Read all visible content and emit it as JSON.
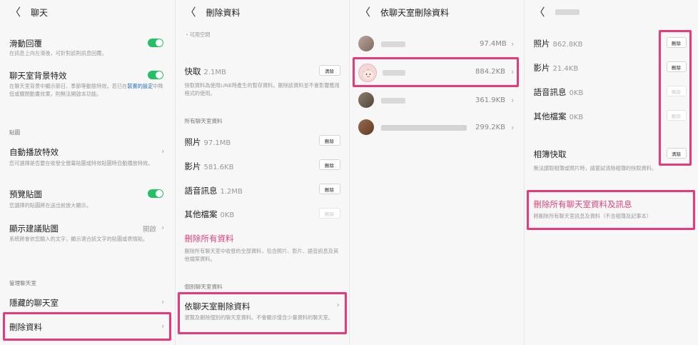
{
  "panel1": {
    "header": {
      "back": "〈",
      "title": "聊天"
    },
    "items": [
      {
        "title": "滑動回覆",
        "desc": "在訊息上向左滑後，可針對該則訊息回覆。"
      },
      {
        "title": "聊天室背景特效",
        "desc1": "在聊天室背景中顯示節日、季節等動態特效。若已在",
        "desc_link": "裝置的設定",
        "desc2": "中降低或關閉動畫效果，則無法開啟本功能。"
      }
    ],
    "section_sticker": "貼圖",
    "autoplay": {
      "title": "自動播放特效",
      "desc": "您可選擇是否要在收發全螢幕貼圖或特效貼圖時自動播放特效。"
    },
    "preview": {
      "title": "預覽貼圖",
      "desc": "您選擇的貼圖將在送出前放大顯示。"
    },
    "suggest": {
      "title": "顯示建議貼圖",
      "value": "開啟",
      "desc": "系統將會依您輸入的文字，顯示適合該文字的貼圖或表情貼。"
    },
    "section_manage": "管理聊天室",
    "hidden": {
      "title": "隱藏的聊天室"
    },
    "delete": {
      "title": "刪除資料"
    },
    "chev": "›"
  },
  "panel2": {
    "header": {
      "back": "〈",
      "title": "刪除資料"
    },
    "top_desc": "・可用空間",
    "cache": {
      "title": "快取",
      "value": "2.1MB",
      "button": "清除",
      "desc": "快取資料為使用LINE時產生的暫存資料。刪除該資料並不會影響應用程式的使用。"
    },
    "section_all": "所有聊天室資料",
    "files": [
      {
        "label": "照片",
        "value": "97.1MB",
        "button": "刪除"
      },
      {
        "label": "影片",
        "value": "581.6KB",
        "button": "刪除"
      },
      {
        "label": "語音訊息",
        "value": "1.2MB",
        "button": "刪除"
      },
      {
        "label": "其他檔案",
        "value": "0KB",
        "button": "刪除"
      }
    ],
    "delete_all": {
      "title": "刪除所有資料",
      "desc": "刪除所有聊天室中收發的全部資料，包含照片、影片、語音訊息及其他檔案資料。"
    },
    "section_single": "個別聊天室資料",
    "by_chat": {
      "title": "依聊天室刪除資料",
      "desc": "瀏覽及刪除個別的聊天室資料。不會顯示僅含少量資料的聊天室。"
    },
    "chev": "›"
  },
  "panel3": {
    "header": {
      "back": "〈",
      "title": "依聊天室刪除資料"
    },
    "rows": [
      {
        "size": "97.4MB"
      },
      {
        "size": "884.2KB"
      },
      {
        "size": "361.9KB"
      },
      {
        "size": "299.2KB"
      }
    ],
    "chev": "›"
  },
  "panel4": {
    "header": {
      "back": "〈"
    },
    "files": [
      {
        "label": "照片",
        "value": "862.8KB",
        "button": "刪除"
      },
      {
        "label": "影片",
        "value": "21.4KB",
        "button": "刪除"
      },
      {
        "label": "語音訊息",
        "value": "0KB",
        "button": "刪除"
      },
      {
        "label": "其他檔案",
        "value": "0KB",
        "button": "刪除"
      }
    ],
    "album": {
      "title": "相簿快取",
      "button": "清除",
      "desc": "無法讀取相簿或照片時，請嘗試清除相簿的快取資料。"
    },
    "delete_all": {
      "title": "刪除所有聊天室資料及訊息",
      "desc": "將刪除所有聊天室訊息及資料（不含相簿及記事本）"
    }
  },
  "colors": {
    "highlight": "#e9397a",
    "toggle_on": "#24c066",
    "danger_text": "#e0427a"
  }
}
